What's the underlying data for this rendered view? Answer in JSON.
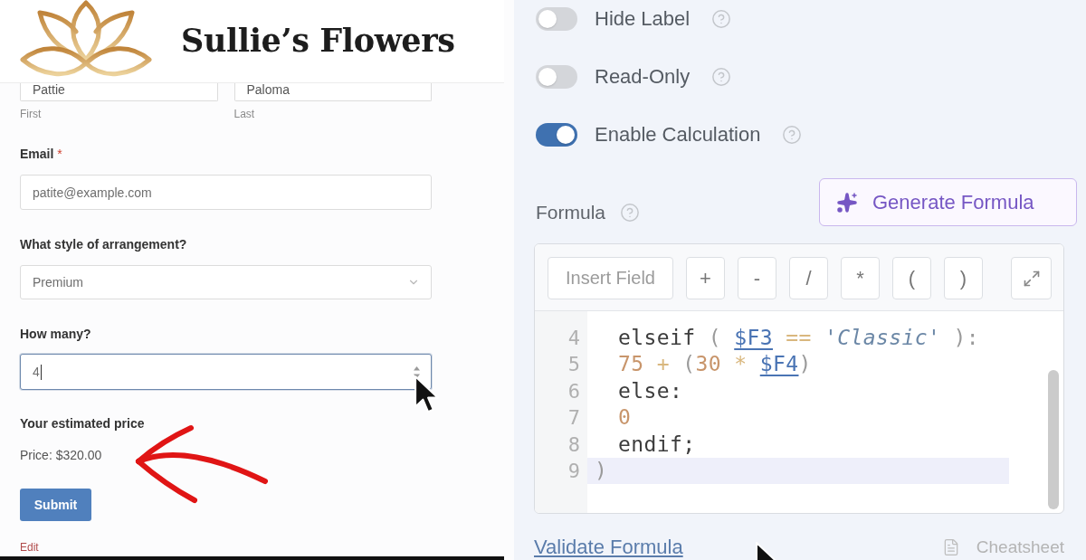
{
  "form_preview": {
    "header": {
      "title": "Sullie’s Flowers"
    },
    "name_fields": [
      {
        "value": "Pattie",
        "sublabel": "First"
      },
      {
        "value": "Paloma",
        "sublabel": "Last"
      }
    ],
    "fields": [
      {
        "kind": "text",
        "label": "Email",
        "required_mark": "*",
        "value": "patite@example.com",
        "focused": false
      },
      {
        "kind": "select",
        "label": "What style of arrangement?",
        "value": "Premium",
        "focused": false
      },
      {
        "kind": "number",
        "label": "How many?",
        "value": "4",
        "focused": true
      }
    ],
    "price_output": {
      "label": "Your estimated price",
      "value": "Price: $320.00"
    },
    "submit_button": "Submit",
    "edit_link": "Edit"
  },
  "settings": {
    "toggles": [
      {
        "label": "Hide Label",
        "on": false
      },
      {
        "label": "Read-Only",
        "on": false
      },
      {
        "label": "Enable Calculation",
        "on": true
      }
    ],
    "formula": {
      "label": "Formula",
      "generate_button": "Generate Formula",
      "toolbar": [
        {
          "kind": "field",
          "label": "Insert Field"
        },
        {
          "kind": "symbol",
          "label": "+"
        },
        {
          "kind": "symbol",
          "label": "-"
        },
        {
          "kind": "symbol",
          "label": "/"
        },
        {
          "kind": "symbol",
          "label": "*"
        },
        {
          "kind": "symbol",
          "label": "("
        },
        {
          "kind": "symbol",
          "label": ")"
        },
        {
          "kind": "expand"
        }
      ],
      "lines": [
        {
          "number": "4",
          "indented": true,
          "active": false,
          "tokens": [
            {
              "text": "elseif",
              "kind": "keyword"
            },
            {
              "text": " ( ",
              "kind": "punct"
            },
            {
              "text": "$F3",
              "kind": "variable"
            },
            {
              "text": " == ",
              "kind": "operator"
            },
            {
              "text": "'Classic'",
              "kind": "string"
            },
            {
              "text": " ):",
              "kind": "punct"
            }
          ]
        },
        {
          "number": "5",
          "indented": true,
          "active": false,
          "tokens": [
            {
              "text": "75",
              "kind": "number"
            },
            {
              "text": " + ",
              "kind": "operator"
            },
            {
              "text": "(",
              "kind": "punct"
            },
            {
              "text": "30",
              "kind": "number"
            },
            {
              "text": " * ",
              "kind": "operator"
            },
            {
              "text": "$F4",
              "kind": "variable"
            },
            {
              "text": ")",
              "kind": "punct"
            }
          ]
        },
        {
          "number": "6",
          "indented": true,
          "active": false,
          "tokens": [
            {
              "text": "else:",
              "kind": "keyword"
            }
          ]
        },
        {
          "number": "7",
          "indented": true,
          "active": false,
          "tokens": [
            {
              "text": "0",
              "kind": "number"
            }
          ]
        },
        {
          "number": "8",
          "indented": true,
          "active": false,
          "tokens": [
            {
              "text": "endif;",
              "kind": "keyword"
            }
          ]
        },
        {
          "number": "9",
          "indented": false,
          "active": true,
          "tokens": [
            {
              "text": ")",
              "kind": "punct"
            }
          ]
        }
      ],
      "validate_link": "Validate Formula",
      "cheatsheet": "Cheatsheet"
    }
  }
}
